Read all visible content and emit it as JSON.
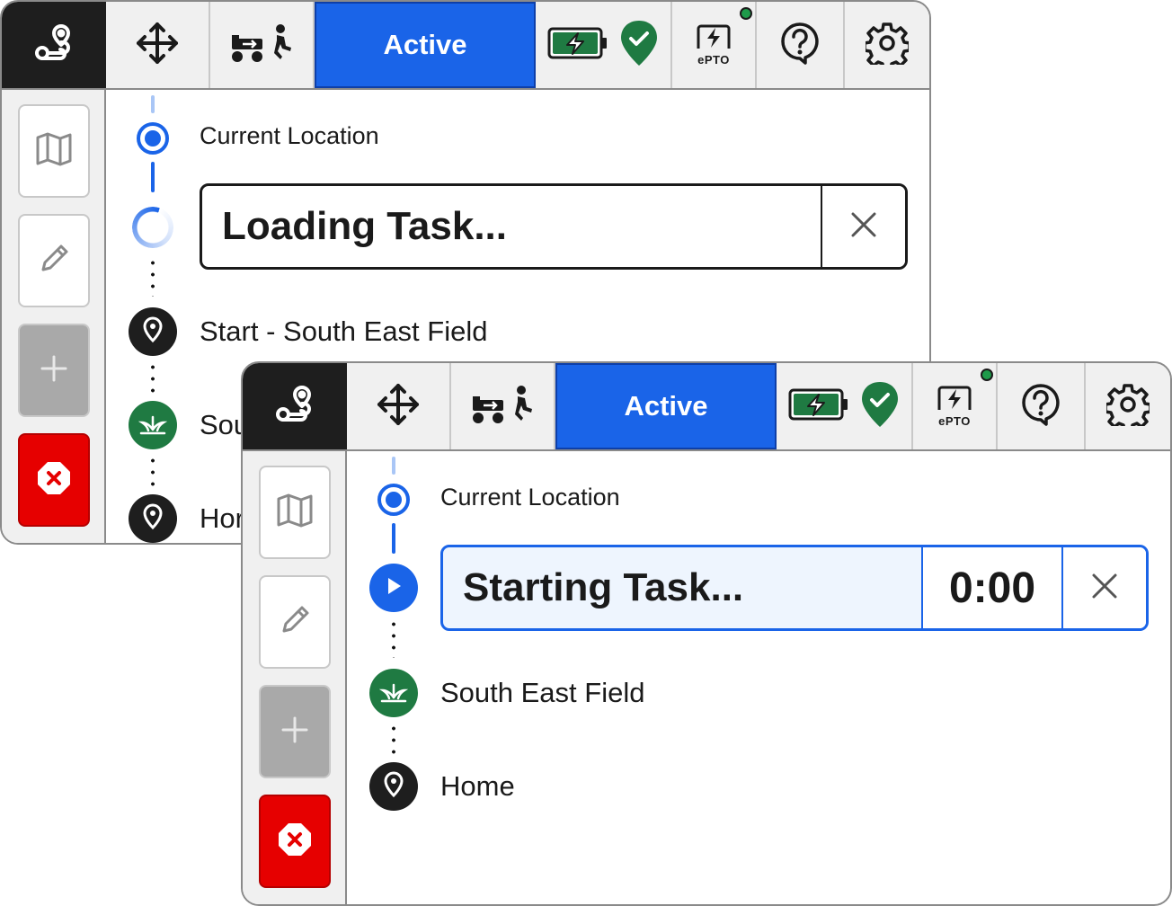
{
  "toolbar": {
    "active_label": "Active",
    "epto_label": "ePTO",
    "icons": {
      "route": "route-icon",
      "move": "move-arrows-icon",
      "follow": "tractor-follow-icon",
      "battery": "battery-charging-icon",
      "shield": "shield-check-icon",
      "epto": "epto-lightning-icon",
      "help": "help-icon",
      "settings": "gear-icon"
    },
    "colors": {
      "active_bg": "#1a64e8",
      "battery": "#1f7a42",
      "epto_status": "#1e9a4a"
    }
  },
  "sidebar": {
    "items": [
      {
        "name": "map",
        "icon": "map-icon"
      },
      {
        "name": "edit",
        "icon": "pencil-icon"
      },
      {
        "name": "add",
        "icon": "plus-icon",
        "disabled": true
      },
      {
        "name": "stop",
        "icon": "stop-x-icon",
        "color": "#e60000"
      }
    ]
  },
  "panel_a": {
    "current_location": "Current Location",
    "task_title": "Loading Task...",
    "stops": [
      {
        "label": "Start - South East Field",
        "icon": "map-pin-icon"
      },
      {
        "label": "Sou",
        "icon": "field-icon"
      },
      {
        "label": "Hor",
        "icon": "map-pin-icon"
      }
    ]
  },
  "panel_b": {
    "current_location": "Current Location",
    "task_title": "Starting Task...",
    "timer": "0:00",
    "stops": [
      {
        "label": "South East Field",
        "icon": "field-icon"
      },
      {
        "label": "Home",
        "icon": "map-pin-icon"
      }
    ]
  }
}
